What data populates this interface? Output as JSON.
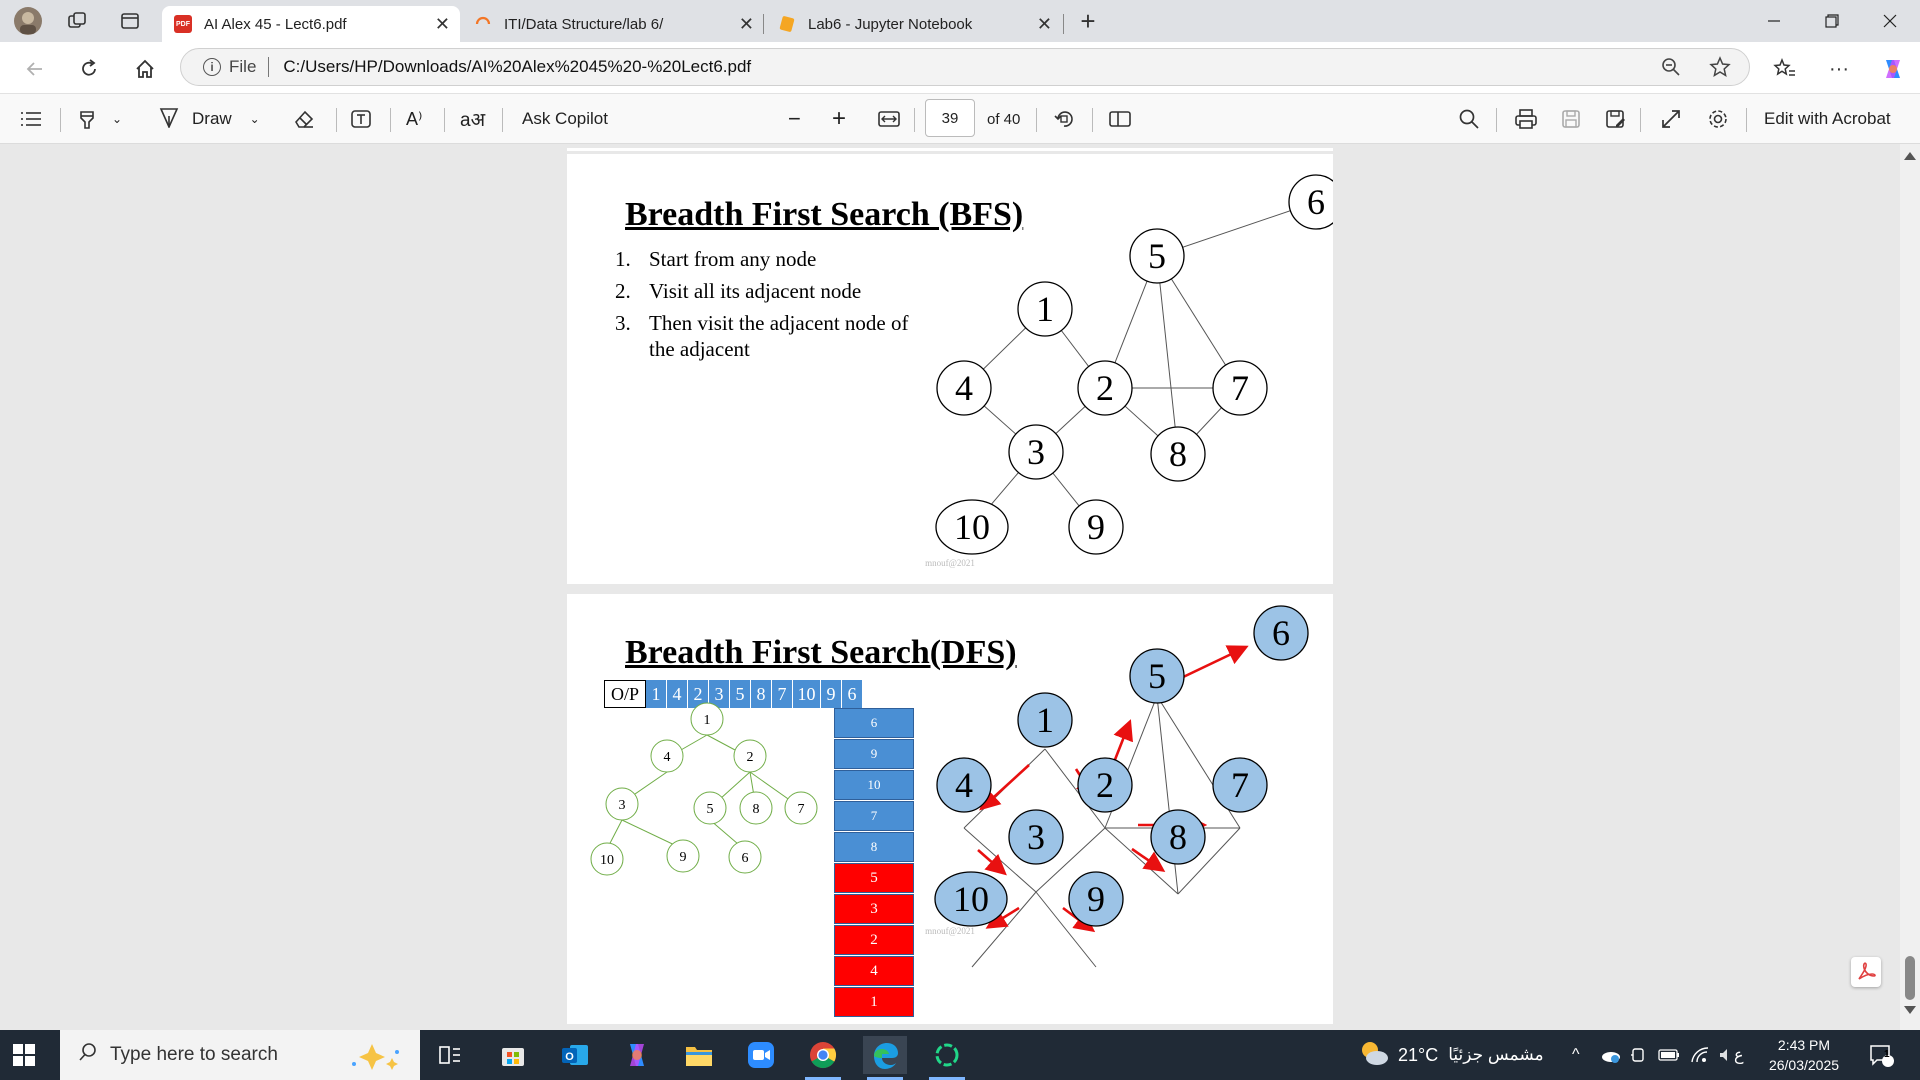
{
  "browser": {
    "tabs": [
      {
        "title": "AI Alex 45 - Lect6.pdf",
        "active": true
      },
      {
        "title": "ITI/Data Structure/lab 6/",
        "active": false
      },
      {
        "title": "Lab6 - Jupyter Notebook",
        "active": false
      }
    ],
    "url_scheme": "File",
    "url": "C:/Users/HP/Downloads/AI%20Alex%2045%20-%20Lect6.pdf"
  },
  "pdf_toolbar": {
    "draw_label": "Draw",
    "copilot_label": "Ask Copilot",
    "page_number": "39",
    "page_total": "of 40",
    "acrobat_label": "Edit with Acrobat",
    "read_aloud_glyph": "A⁾",
    "translate_glyph": "aअ"
  },
  "slide1": {
    "title": "Breadth First Search (BFS)",
    "steps": [
      {
        "num": "1.",
        "text": "Start from any node"
      },
      {
        "num": "2.",
        "text": "Visit all its adjacent node"
      },
      {
        "num": "3.",
        "text": "Then visit the adjacent node of",
        "cont": "the adjacent"
      }
    ],
    "nodes": [
      "1",
      "2",
      "3",
      "4",
      "5",
      "6",
      "7",
      "8",
      "9",
      "10"
    ],
    "footer": "mnouf@2021"
  },
  "slide2": {
    "title": "Breadth First Search(DFS)",
    "op_label": "O/P",
    "op_values": [
      "1",
      "4",
      "2",
      "3",
      "5",
      "8",
      "7",
      "10",
      "9",
      "6"
    ],
    "stack_blue": [
      "6",
      "9",
      "10",
      "7",
      "8"
    ],
    "stack_red": [
      "5",
      "3",
      "2",
      "4",
      "1"
    ],
    "tree_nodes": [
      "1",
      "4",
      "2",
      "3",
      "5",
      "8",
      "7",
      "10",
      "9",
      "6"
    ],
    "graph_nodes": [
      "1",
      "2",
      "3",
      "4",
      "5",
      "6",
      "7",
      "8",
      "9",
      "10"
    ],
    "footer": "mnouf@2021"
  },
  "taskbar": {
    "search_placeholder": "Type here to search",
    "temperature": "21°C",
    "weather_text": "مشمس جزئيًا",
    "lang": "ع",
    "time": "2:43 PM",
    "date": "26/03/2025",
    "notification_count": "1"
  },
  "colors": {
    "node_blue": "#9cc3e6",
    "stack_blue": "#4a8fd4",
    "stack_red": "#ff0000",
    "arrow_red": "#e81010",
    "tree_green": "#70ad47",
    "taskbar_bg": "#202a36"
  }
}
